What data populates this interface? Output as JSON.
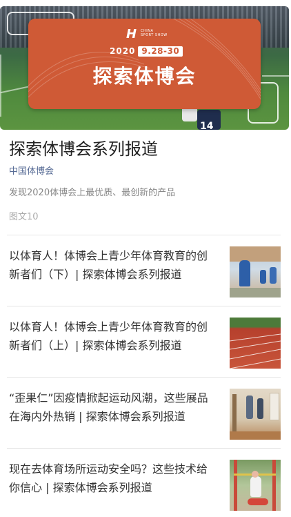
{
  "banner": {
    "date_year": "2020",
    "date_range": "9.28-30",
    "title": "探索体博会",
    "logo_text_line1": "CHINA",
    "logo_text_line2": "SPORT SHOW",
    "player_number": "14"
  },
  "header": {
    "title": "探索体博会系列报道",
    "account": "中国体博会",
    "description": "发现2020体博会上最优质、最创新的产品",
    "count": "图文10"
  },
  "articles": [
    {
      "title": "以体育人！体博会上青少年体育教育的创新者们（下）| 探索体博会系列报道"
    },
    {
      "title": "以体育人！体博会上青少年体育教育的创新者们（上）| 探索体博会系列报道"
    },
    {
      "title": "“歪果仁”因疫情掀起运动风潮，这些展品在海内外热销 | 探索体博会系列报道"
    },
    {
      "title": "现在去体育场所运动安全吗？这些技术给你信心 | 探索体博会系列报道"
    }
  ],
  "colors": {
    "card": "#cf5a36",
    "account_link": "#576b95"
  }
}
